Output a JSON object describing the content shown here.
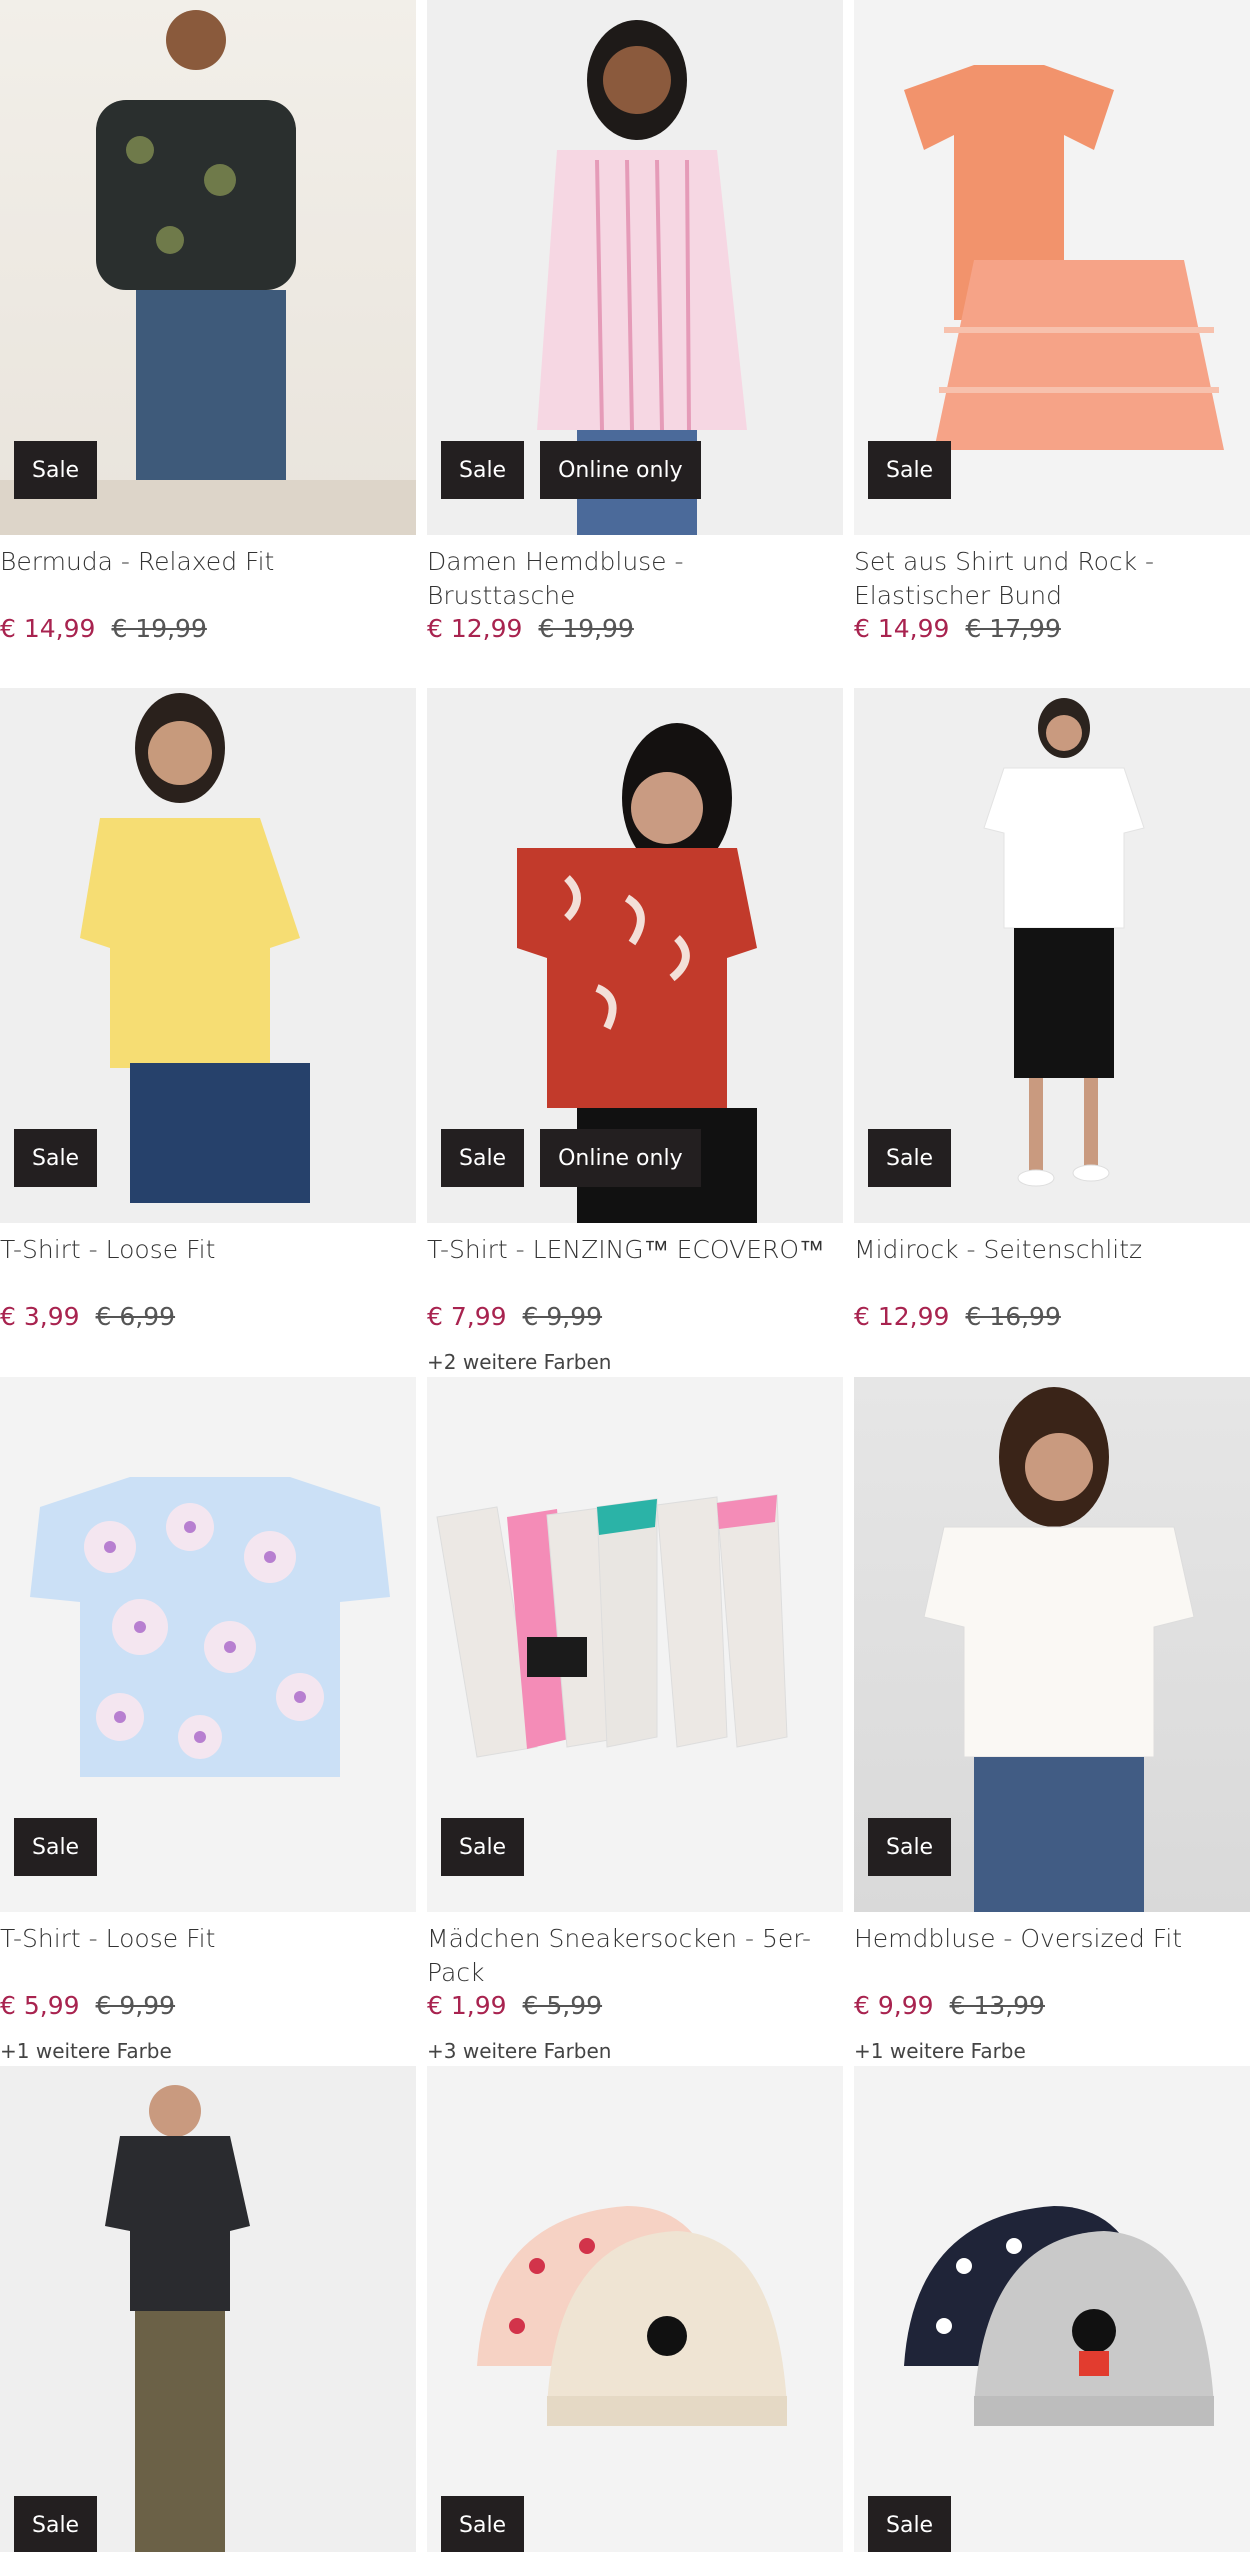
{
  "products": [
    {
      "title": "Bermuda - Relaxed Fit",
      "price": "€ 14,99",
      "old_price": "€ 19,99",
      "badges": [
        "Sale"
      ],
      "colors_note": ""
    },
    {
      "title": "Damen Hemdbluse - Brusttasche",
      "price": "€ 12,99",
      "old_price": "€ 19,99",
      "badges": [
        "Sale",
        "Online only"
      ],
      "colors_note": ""
    },
    {
      "title": "Set aus Shirt und Rock - Elastischer Bund",
      "price": "€ 14,99",
      "old_price": "€ 17,99",
      "badges": [
        "Sale"
      ],
      "colors_note": ""
    },
    {
      "title": "T-Shirt - Loose Fit",
      "price": "€ 3,99",
      "old_price": "€ 6,99",
      "badges": [
        "Sale"
      ],
      "colors_note": ""
    },
    {
      "title": "T-Shirt - LENZING™ ECOVERO™",
      "price": "€ 7,99",
      "old_price": "€ 9,99",
      "badges": [
        "Sale",
        "Online only"
      ],
      "colors_note": "+2 weitere Farben"
    },
    {
      "title": "Midirock - Seitenschlitz",
      "price": "€ 12,99",
      "old_price": "€ 16,99",
      "badges": [
        "Sale"
      ],
      "colors_note": ""
    },
    {
      "title": "T-Shirt - Loose Fit",
      "price": "€ 5,99",
      "old_price": "€ 9,99",
      "badges": [
        "Sale"
      ],
      "colors_note": "+1 weitere Farbe"
    },
    {
      "title": "Mädchen Sneakersocken - 5er-Pack",
      "price": "€ 1,99",
      "old_price": "€ 5,99",
      "badges": [
        "Sale"
      ],
      "colors_note": "+3 weitere Farben"
    },
    {
      "title": "Hemdbluse - Oversized Fit",
      "price": "€ 9,99",
      "old_price": "€ 13,99",
      "badges": [
        "Sale"
      ],
      "colors_note": "+1 weitere Farbe"
    },
    {
      "title": "",
      "price": "",
      "old_price": "",
      "badges": [
        "Sale"
      ],
      "colors_note": ""
    },
    {
      "title": "",
      "price": "",
      "old_price": "",
      "badges": [
        "Sale"
      ],
      "colors_note": ""
    },
    {
      "title": "",
      "price": "",
      "old_price": "",
      "badges": [
        "Sale"
      ],
      "colors_note": ""
    }
  ],
  "colors": {
    "badge_bg": "#231f20",
    "sale_price": "#a8234f"
  }
}
